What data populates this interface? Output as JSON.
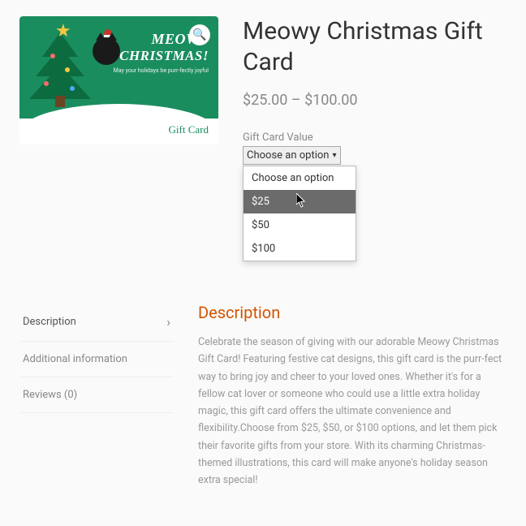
{
  "product": {
    "title": "Meowy Christmas Gift Card",
    "price_range": "$25.00 – $100.00",
    "image_card": {
      "line1": "MEOWY",
      "line2": "CHRISTMAS!",
      "tagline": "May your holidays be purr-fectly joyful",
      "footer_label": "Gift Card"
    }
  },
  "variation": {
    "label": "Gift Card Value",
    "selected": "Choose an option",
    "options": [
      "Choose an option",
      "$25",
      "$50",
      "$100"
    ],
    "hovered_index": 1
  },
  "tabs": {
    "items": [
      {
        "label": "Description",
        "active": true
      },
      {
        "label": "Additional information",
        "active": false
      },
      {
        "label": "Reviews (0)",
        "active": false
      }
    ]
  },
  "description": {
    "heading": "Description",
    "body": "Celebrate the season of giving with our adorable Meowy Christmas Gift Card! Featuring festive cat designs, this gift card is the purr-fect way to bring joy and cheer to your loved ones. Whether it's for a fellow cat lover or someone who could use a little extra holiday magic, this gift card offers the ultimate convenience and flexibility.Choose from $25, $50, or $100 options, and let them pick their favorite gifts from your store. With its charming Christmas-themed illustrations, this card will make anyone's holiday season extra special!"
  }
}
